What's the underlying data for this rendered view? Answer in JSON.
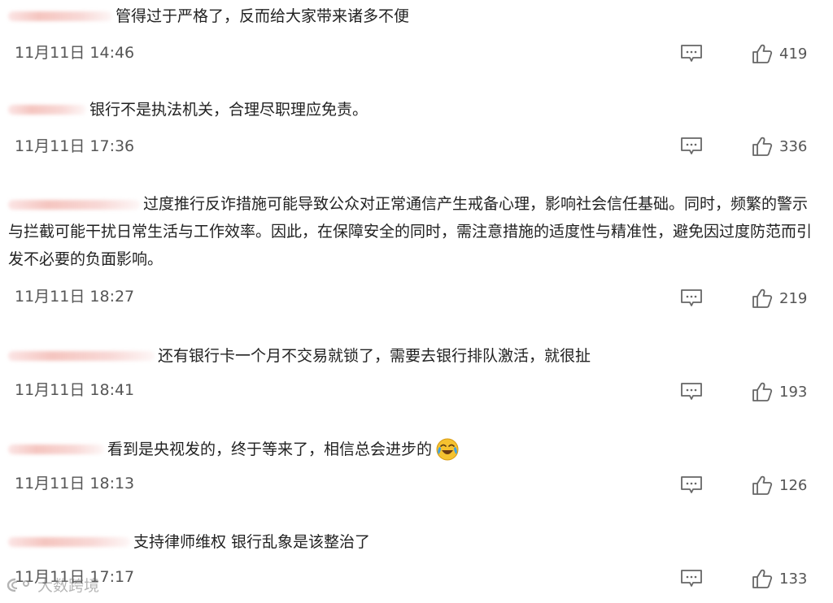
{
  "comments": [
    {
      "text": "管得过于严格了，反而给大家带来诸多不便",
      "time": "11月11日 14:46",
      "likes": "419"
    },
    {
      "text": "银行不是执法机关，合理尽职理应免责。",
      "time": "11月11日 17:36",
      "likes": "336"
    },
    {
      "text": "过度推行反诈措施可能导致公众对正常通信产生戒备心理，影响社会信任基础。同时，频繁的警示与拦截可能干扰日常生活与工作效率。因此，在保障安全的同时，需注意措施的适度性与精准性，避免因过度防范而引发不必要的负面影响。",
      "time": "11月11日 18:27",
      "likes": "219"
    },
    {
      "text": "还有银行卡一个月不交易就锁了，需要去银行排队激活，就很扯",
      "time": "11月11日 18:41",
      "likes": "193"
    },
    {
      "text": "看到是央视发的，终于等来了，相信总会进步的",
      "time": "11月11日 18:13",
      "likes": "126",
      "emoji": "crying-laughing-emoji"
    },
    {
      "text": "支持律师维权 银行乱象是该整治了",
      "time": "11月11日 17:17",
      "likes": "133"
    }
  ],
  "icons": {
    "reply": "comment-icon",
    "like": "thumbs-up-icon"
  },
  "watermark": {
    "text": "大数跨境",
    "logo": "watermark-logo"
  },
  "colors": {
    "text": "#222222",
    "meta": "#555555",
    "icon": "#666666"
  }
}
